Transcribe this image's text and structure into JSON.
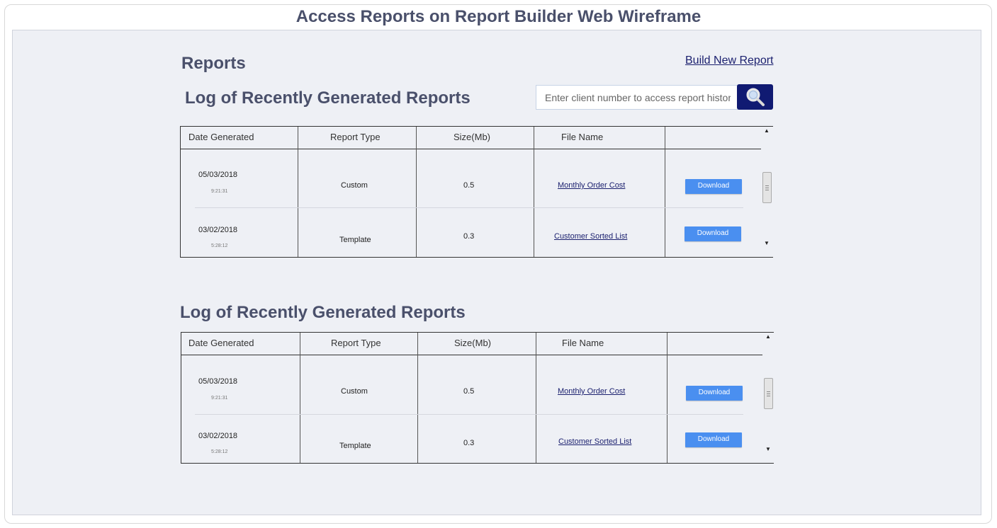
{
  "page": {
    "title": "Access Reports on Report Builder Web Wireframe",
    "reports_heading": "Reports",
    "build_new_report": "Build New Report",
    "log_heading_1": "Log of Recently Generated Reports",
    "log_heading_2": "Log of Recently Generated Reports"
  },
  "search": {
    "placeholder": "Enter client number to access report history",
    "icon": "magnifier-icon"
  },
  "table": {
    "columns": [
      "Date Generated",
      "Report Type",
      "Size(Mb)",
      "File Name",
      ""
    ],
    "rows": [
      {
        "date": "05/03/2018",
        "time": "9:21:31",
        "type": "Custom",
        "size": "0.5",
        "file": "Monthly Order Cost",
        "action": "Download"
      },
      {
        "date": "03/02/2018",
        "time": "5:28:12",
        "type": "Template",
        "size": "0.3",
        "file": "Customer Sorted List",
        "action": "Download"
      }
    ]
  },
  "colors": {
    "heading": "#4a506b",
    "canvas_bg": "#eef0f5",
    "search_button": "#101a72",
    "download_button": "#4a8ff0",
    "link": "#1a1f6e"
  }
}
